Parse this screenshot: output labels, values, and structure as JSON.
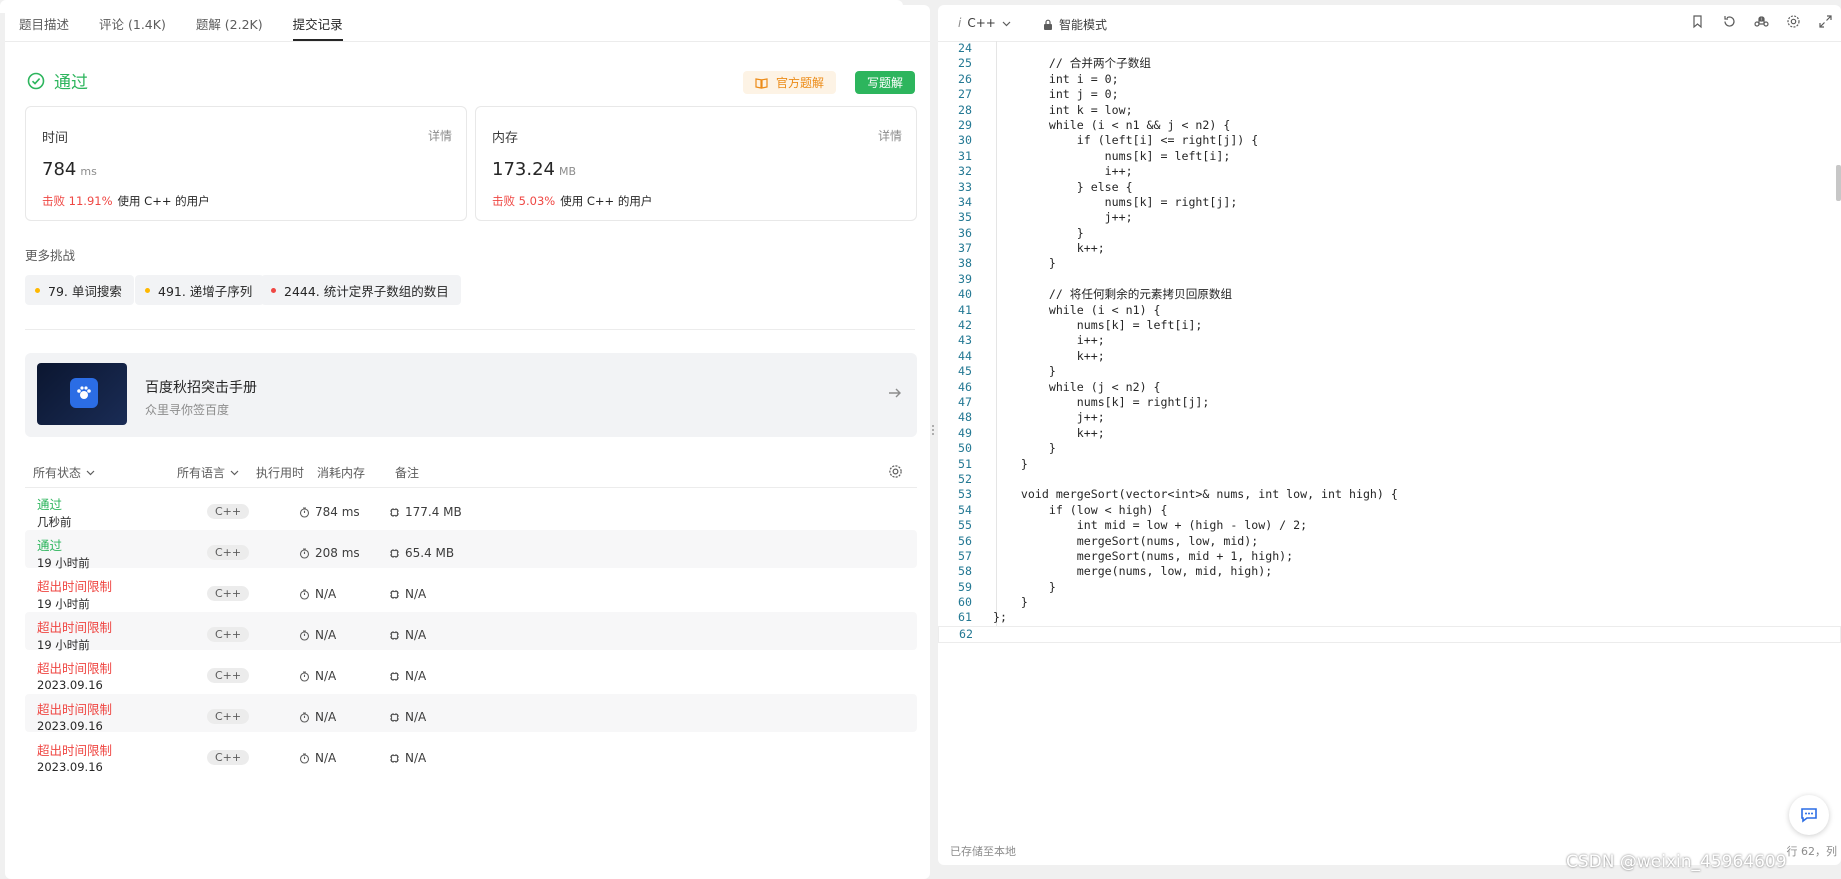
{
  "tabs": [
    "题目描述",
    "评论 (1.4K)",
    "题解 (2.2K)",
    "提交记录"
  ],
  "status": {
    "label": "通过",
    "official_btn": "官方题解",
    "write_btn": "写题解"
  },
  "stats": {
    "time": {
      "title": "时间",
      "detail": "详情",
      "value": "784",
      "unit": "ms",
      "beat": "击败 11.91%",
      "note": "使用 C++ 的用户"
    },
    "memory": {
      "title": "内存",
      "detail": "详情",
      "value": "173.24",
      "unit": "MB",
      "beat": "击败 5.03%",
      "note": "使用 C++ 的用户"
    }
  },
  "more": {
    "title": "更多挑战",
    "chips": [
      {
        "label": "79. 单词搜索",
        "color": "#ffb800"
      },
      {
        "label": "491. 递增子序列",
        "color": "#ffb800"
      },
      {
        "label": "2444. 统计定界子数组的数目",
        "color": "#ef4743"
      }
    ]
  },
  "banner": {
    "title": "百度秋招突击手册",
    "subtitle": "众里寻你签百度"
  },
  "table": {
    "headers": {
      "status": "所有状态",
      "lang": "所有语言",
      "runtime": "执行用时",
      "memory": "消耗内存",
      "note": "备注"
    },
    "rows": [
      {
        "status": "通过",
        "kind": "ok",
        "time": "几秒前",
        "lang": "C++",
        "runtime": "784 ms",
        "memory": "177.4 MB"
      },
      {
        "status": "通过",
        "kind": "ok",
        "time": "19 小时前",
        "lang": "C++",
        "runtime": "208 ms",
        "memory": "65.4 MB"
      },
      {
        "status": "超出时间限制",
        "kind": "tle",
        "time": "19 小时前",
        "lang": "C++",
        "runtime": "N/A",
        "memory": "N/A"
      },
      {
        "status": "超出时间限制",
        "kind": "tle",
        "time": "19 小时前",
        "lang": "C++",
        "runtime": "N/A",
        "memory": "N/A"
      },
      {
        "status": "超出时间限制",
        "kind": "tle",
        "time": "2023.09.16",
        "lang": "C++",
        "runtime": "N/A",
        "memory": "N/A"
      },
      {
        "status": "超出时间限制",
        "kind": "tle",
        "time": "2023.09.16",
        "lang": "C++",
        "runtime": "N/A",
        "memory": "N/A"
      },
      {
        "status": "超出时间限制",
        "kind": "tle",
        "time": "2023.09.16",
        "lang": "C++",
        "runtime": "N/A",
        "memory": "N/A"
      }
    ]
  },
  "editor": {
    "language": "C++",
    "mode": "智能模式",
    "saved": "已存储至本地",
    "rowcol": "行 62，列",
    "watermark": "CSDN @weixin_45964609",
    "lines": [
      {
        "n": 24,
        "code": ""
      },
      {
        "n": 25,
        "code": "        // 合并两个子数组"
      },
      {
        "n": 26,
        "code": "        int i = 0;"
      },
      {
        "n": 27,
        "code": "        int j = 0;"
      },
      {
        "n": 28,
        "code": "        int k = low;"
      },
      {
        "n": 29,
        "code": "        while (i < n1 && j < n2) {"
      },
      {
        "n": 30,
        "code": "            if (left[i] <= right[j]) {"
      },
      {
        "n": 31,
        "code": "                nums[k] = left[i];"
      },
      {
        "n": 32,
        "code": "                i++;"
      },
      {
        "n": 33,
        "code": "            } else {"
      },
      {
        "n": 34,
        "code": "                nums[k] = right[j];"
      },
      {
        "n": 35,
        "code": "                j++;"
      },
      {
        "n": 36,
        "code": "            }"
      },
      {
        "n": 37,
        "code": "            k++;"
      },
      {
        "n": 38,
        "code": "        }"
      },
      {
        "n": 39,
        "code": ""
      },
      {
        "n": 40,
        "code": "        // 将任何剩余的元素拷贝回原数组"
      },
      {
        "n": 41,
        "code": "        while (i < n1) {"
      },
      {
        "n": 42,
        "code": "            nums[k] = left[i];"
      },
      {
        "n": 43,
        "code": "            i++;"
      },
      {
        "n": 44,
        "code": "            k++;"
      },
      {
        "n": 45,
        "code": "        }"
      },
      {
        "n": 46,
        "code": "        while (j < n2) {"
      },
      {
        "n": 47,
        "code": "            nums[k] = right[j];"
      },
      {
        "n": 48,
        "code": "            j++;"
      },
      {
        "n": 49,
        "code": "            k++;"
      },
      {
        "n": 50,
        "code": "        }"
      },
      {
        "n": 51,
        "code": "    }"
      },
      {
        "n": 52,
        "code": ""
      },
      {
        "n": 53,
        "code": "    void mergeSort(vector<int>& nums, int low, int high) {"
      },
      {
        "n": 54,
        "code": "        if (low < high) {"
      },
      {
        "n": 55,
        "code": "            int mid = low + (high - low) / 2;"
      },
      {
        "n": 56,
        "code": "            mergeSort(nums, low, mid);"
      },
      {
        "n": 57,
        "code": "            mergeSort(nums, mid + 1, high);"
      },
      {
        "n": 58,
        "code": "            merge(nums, low, mid, high);"
      },
      {
        "n": 59,
        "code": "        }"
      },
      {
        "n": 60,
        "code": "    }"
      },
      {
        "n": 61,
        "code": "};"
      },
      {
        "n": 62,
        "code": ""
      }
    ]
  }
}
